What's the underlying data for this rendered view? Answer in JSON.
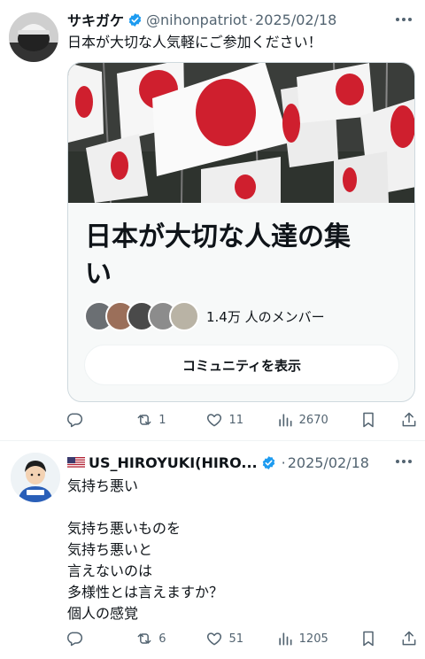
{
  "tweets": [
    {
      "name": "サキガケ",
      "handle": "@nihonpatriot",
      "separator": "·",
      "date": "2025/02/18",
      "text": "日本が大切な人気軽にご参加ください！",
      "community": {
        "title": "日本が大切な人達の集い",
        "member_count": "1.4万 人のメンバー",
        "button_label": "コミュニティを表示"
      },
      "stats": {
        "replies": "",
        "reposts": "1",
        "likes": "11",
        "views": "2670"
      }
    },
    {
      "name": "US_HIROYUKI(HIRO...",
      "flag": "🇺🇸",
      "separator": "·",
      "date": "2025/02/18",
      "text": "気持ち悪い\n\n気持ち悪いものを\n気持ち悪いと\n言えないのは\n多様性とは言えますか？\n個人の感覚",
      "stats": {
        "replies": "",
        "reposts": "6",
        "likes": "51",
        "views": "1205"
      }
    }
  ],
  "colors": {
    "accent": "#1d9bf0",
    "text": "#0f1419",
    "muted": "#536471",
    "flag_red": "#cf1f2e"
  }
}
